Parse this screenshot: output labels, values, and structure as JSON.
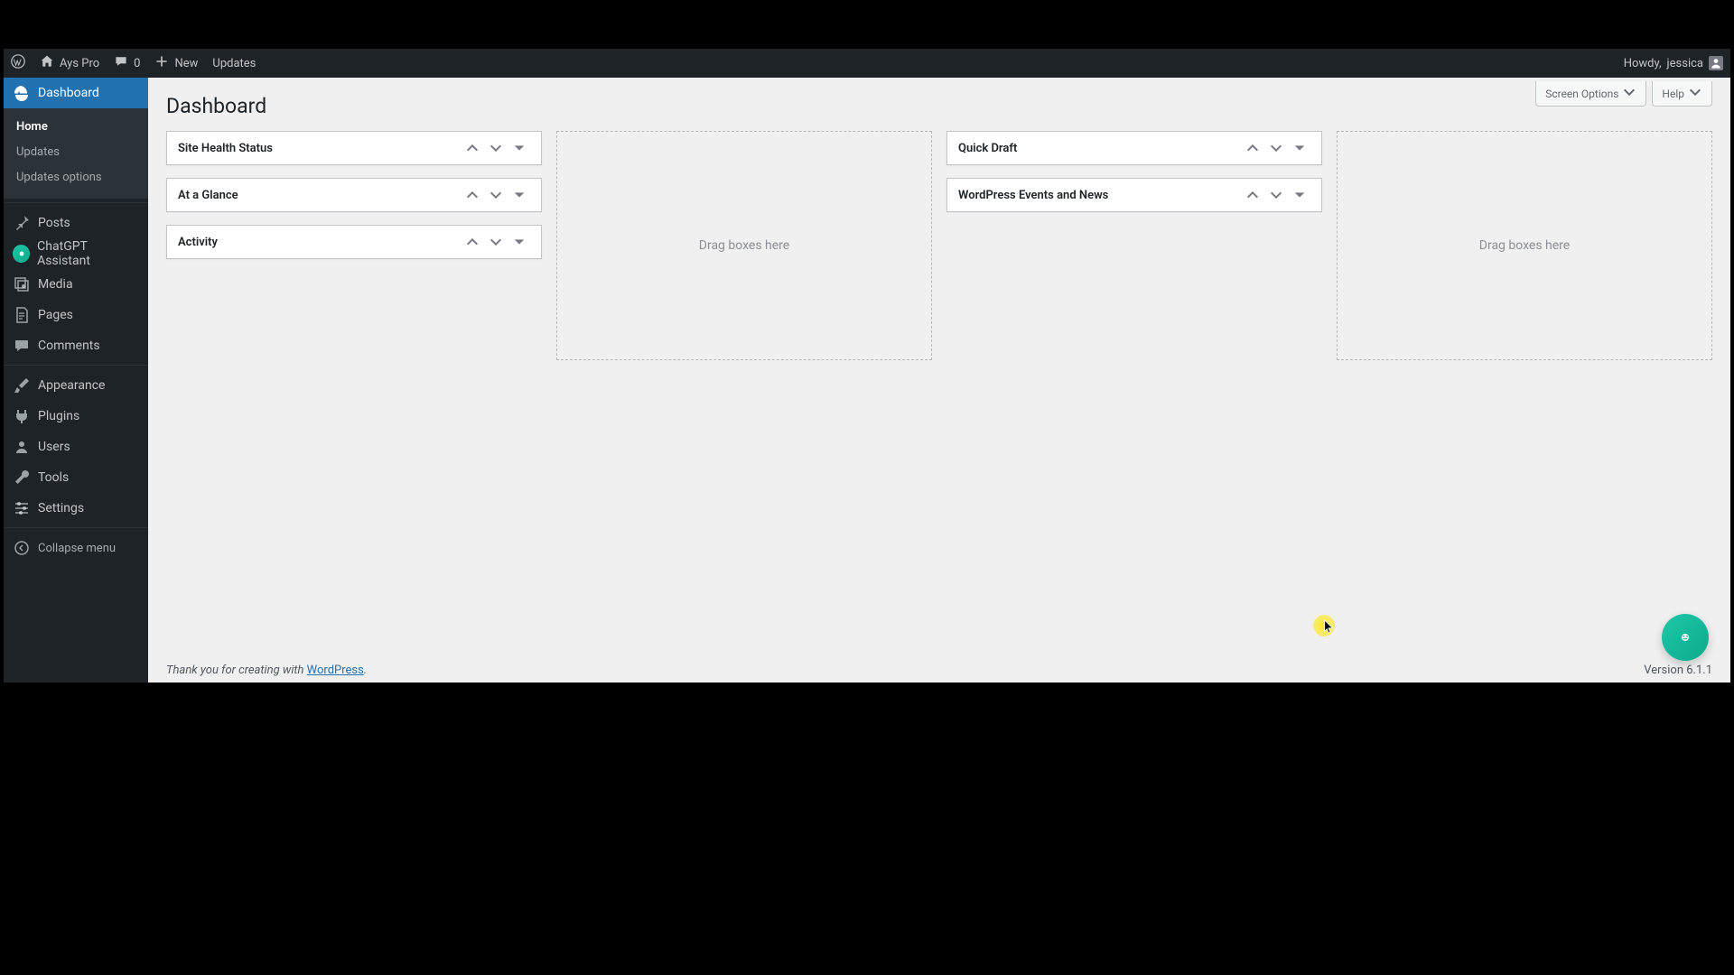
{
  "adminbar": {
    "site_name": "Ays Pro",
    "comments_count": "0",
    "new_label": "New",
    "updates_label": "Updates",
    "howdy_prefix": "Howdy, ",
    "user_name": "jessica"
  },
  "sidebar": {
    "dashboard": "Dashboard",
    "submenu": {
      "home": "Home",
      "updates": "Updates",
      "updates_options": "Updates options"
    },
    "posts": "Posts",
    "chatgpt": "ChatGPT Assistant",
    "media": "Media",
    "pages": "Pages",
    "comments": "Comments",
    "appearance": "Appearance",
    "plugins": "Plugins",
    "users": "Users",
    "tools": "Tools",
    "settings": "Settings",
    "collapse": "Collapse menu"
  },
  "page": {
    "title": "Dashboard",
    "screen_options": "Screen Options",
    "help": "Help"
  },
  "col1": {
    "site_health": "Site Health Status",
    "at_a_glance": "At a Glance",
    "activity": "Activity"
  },
  "col3": {
    "quick_draft": "Quick Draft",
    "wp_events": "WordPress Events and News"
  },
  "dropzone": "Drag boxes here",
  "footer": {
    "text": "Thank you for creating with ",
    "link": "WordPress",
    "version": "Version 6.1.1"
  }
}
